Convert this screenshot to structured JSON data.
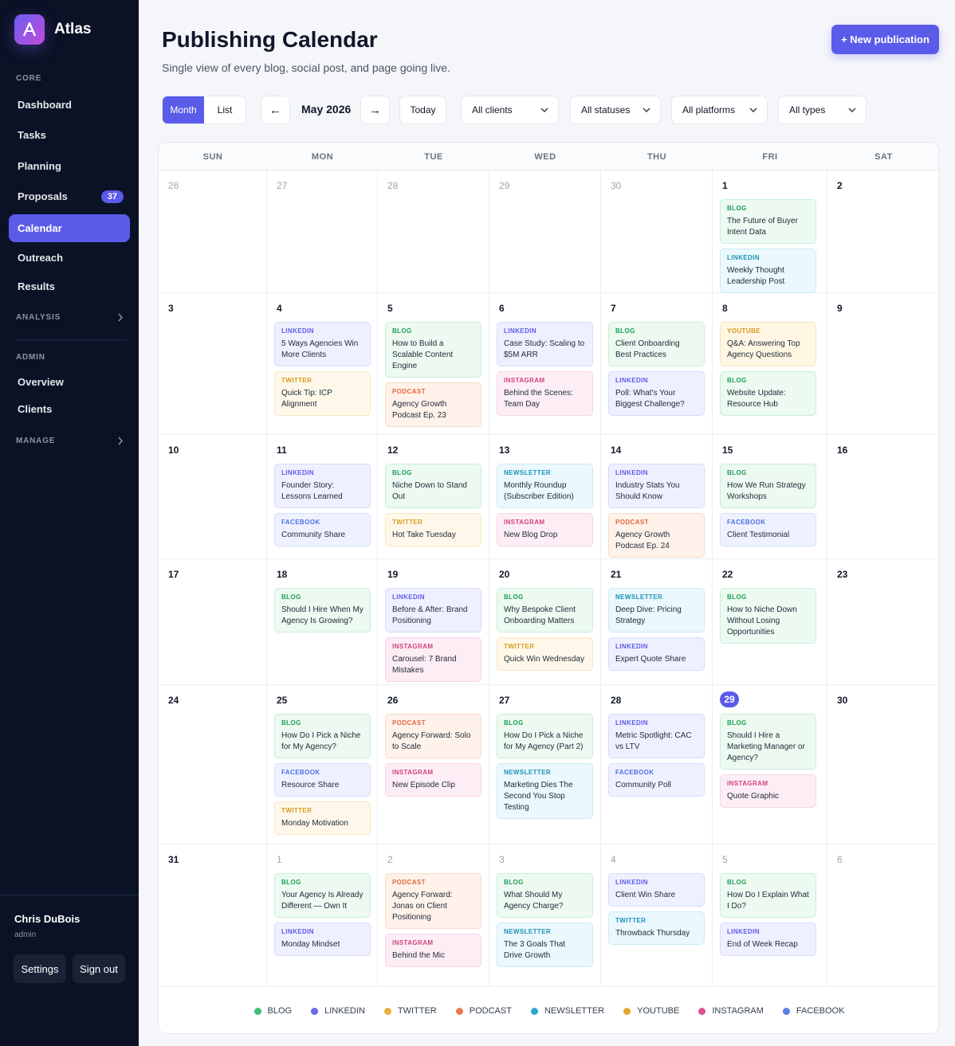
{
  "brand": {
    "name": "Atlas"
  },
  "sidebar": {
    "core_label": "CORE",
    "items": [
      {
        "label": "Dashboard"
      },
      {
        "label": "Tasks"
      },
      {
        "label": "Planning"
      },
      {
        "label": "Proposals",
        "badge": "37"
      },
      {
        "label": "Calendar"
      },
      {
        "label": "Outreach"
      },
      {
        "label": "Results"
      }
    ],
    "analysis_label": "ANALYSIS",
    "admin_label": "ADMIN",
    "admin_items": [
      {
        "label": "Overview"
      },
      {
        "label": "Clients"
      }
    ],
    "manage_label": "MANAGE",
    "user": {
      "name": "Chris DuBois",
      "role": "admin"
    },
    "settings_label": "Settings",
    "signout_label": "Sign out"
  },
  "header": {
    "title": "Publishing Calendar",
    "subtitle": "Single view of every blog, social post, and page going live.",
    "new_button": "+ New publication"
  },
  "toolbar": {
    "view_month": "Month",
    "view_list": "List",
    "prev": "←",
    "next": "→",
    "month": "May 2026",
    "today": "Today",
    "filters": [
      "All clients",
      "All statuses",
      "All platforms",
      "All types"
    ]
  },
  "calendar": {
    "weekdays": [
      "SUN",
      "MON",
      "TUE",
      "WED",
      "THU",
      "FRI",
      "SAT"
    ],
    "today": "29",
    "weeks": [
      [
        {
          "d": "26",
          "out": true,
          "e": []
        },
        {
          "d": "27",
          "out": true,
          "e": []
        },
        {
          "d": "28",
          "out": true,
          "e": []
        },
        {
          "d": "29",
          "out": true,
          "e": []
        },
        {
          "d": "30",
          "out": true,
          "e": []
        },
        {
          "d": "1",
          "e": [
            {
              "t": "blog",
              "tag": "BLOG",
              "title": "The Future of Buyer Intent Data"
            },
            {
              "t": "newsletter",
              "tag": "LINKEDIN",
              "title": "Weekly Thought Leadership Post"
            }
          ]
        },
        {
          "d": "2",
          "e": []
        }
      ],
      [
        {
          "d": "3",
          "e": []
        },
        {
          "d": "4",
          "e": [
            {
              "t": "linkedin",
              "tag": "LINKEDIN",
              "title": "5 Ways Agencies Win More Clients"
            },
            {
              "t": "twitter",
              "tag": "TWITTER",
              "title": "Quick Tip: ICP Alignment"
            }
          ]
        },
        {
          "d": "5",
          "e": [
            {
              "t": "blog",
              "tag": "BLOG",
              "title": "How to Build a Scalable Content Engine"
            },
            {
              "t": "podcast",
              "tag": "PODCAST",
              "title": "Agency Growth Podcast Ep. 23"
            }
          ]
        },
        {
          "d": "6",
          "e": [
            {
              "t": "linkedin",
              "tag": "LINKEDIN",
              "title": "Case Study: Scaling to $5M ARR"
            },
            {
              "t": "instagram",
              "tag": "INSTAGRAM",
              "title": "Behind the Scenes: Team Day"
            }
          ]
        },
        {
          "d": "7",
          "e": [
            {
              "t": "blog",
              "tag": "BLOG",
              "title": "Client Onboarding Best Practices"
            },
            {
              "t": "linkedin",
              "tag": "LINKEDIN",
              "title": "Poll: What's Your Biggest Challenge?"
            }
          ]
        },
        {
          "d": "8",
          "e": [
            {
              "t": "youtube",
              "tag": "YOUTUBE",
              "title": "Q&A: Answering Top Agency Questions"
            },
            {
              "t": "blog",
              "tag": "BLOG",
              "title": "Website Update: Resource Hub"
            }
          ]
        },
        {
          "d": "9",
          "e": []
        }
      ],
      [
        {
          "d": "10",
          "e": []
        },
        {
          "d": "11",
          "e": [
            {
              "t": "linkedin",
              "tag": "LINKEDIN",
              "title": "Founder Story: Lessons Learned"
            },
            {
              "t": "facebook",
              "tag": "FACEBOOK",
              "title": "Community Share"
            }
          ]
        },
        {
          "d": "12",
          "e": [
            {
              "t": "blog",
              "tag": "BLOG",
              "title": "Niche Down to Stand Out"
            },
            {
              "t": "twitter",
              "tag": "TWITTER",
              "title": "Hot Take Tuesday"
            }
          ]
        },
        {
          "d": "13",
          "e": [
            {
              "t": "newsletter",
              "tag": "NEWSLETTER",
              "title": "Monthly Roundup (Subscriber Edition)"
            },
            {
              "t": "instagram",
              "tag": "INSTAGRAM",
              "title": "New Blog Drop"
            }
          ]
        },
        {
          "d": "14",
          "e": [
            {
              "t": "linkedin",
              "tag": "LINKEDIN",
              "title": "Industry Stats You Should Know"
            },
            {
              "t": "podcast",
              "tag": "PODCAST",
              "title": "Agency Growth Podcast Ep. 24"
            }
          ]
        },
        {
          "d": "15",
          "e": [
            {
              "t": "blog",
              "tag": "BLOG",
              "title": "How We Run Strategy Workshops"
            },
            {
              "t": "facebook",
              "tag": "FACEBOOK",
              "title": "Client Testimonial"
            }
          ]
        },
        {
          "d": "16",
          "e": []
        }
      ],
      [
        {
          "d": "17",
          "e": []
        },
        {
          "d": "18",
          "e": [
            {
              "t": "blog",
              "tag": "BLOG",
              "title": "Should I Hire When My Agency Is Growing?"
            }
          ]
        },
        {
          "d": "19",
          "e": [
            {
              "t": "linkedin",
              "tag": "LINKEDIN",
              "title": "Before & After: Brand Positioning"
            },
            {
              "t": "instagram",
              "tag": "INSTAGRAM",
              "title": "Carousel: 7 Brand Mistakes"
            }
          ]
        },
        {
          "d": "20",
          "e": [
            {
              "t": "blog",
              "tag": "BLOG",
              "title": "Why Bespoke Client Onboarding Matters"
            },
            {
              "t": "twitter",
              "tag": "TWITTER",
              "title": "Quick Win Wednesday"
            }
          ]
        },
        {
          "d": "21",
          "e": [
            {
              "t": "newsletter",
              "tag": "NEWSLETTER",
              "title": "Deep Dive: Pricing Strategy"
            },
            {
              "t": "linkedin",
              "tag": "LINKEDIN",
              "title": "Expert Quote Share"
            }
          ]
        },
        {
          "d": "22",
          "e": [
            {
              "t": "blog",
              "tag": "BLOG",
              "title": "How to Niche Down Without Losing Opportunities"
            }
          ]
        },
        {
          "d": "23",
          "e": []
        }
      ],
      [
        {
          "d": "24",
          "e": []
        },
        {
          "d": "25",
          "e": [
            {
              "t": "blog",
              "tag": "BLOG",
              "title": "How Do I Pick a Niche for My Agency?"
            },
            {
              "t": "facebook",
              "tag": "FACEBOOK",
              "title": "Resource Share"
            },
            {
              "t": "twitter",
              "tag": "TWITTER",
              "title": "Monday Motivation"
            }
          ]
        },
        {
          "d": "26",
          "e": [
            {
              "t": "podcast",
              "tag": "PODCAST",
              "title": "Agency Forward: Solo to Scale"
            },
            {
              "t": "instagram",
              "tag": "INSTAGRAM",
              "title": "New Episode Clip"
            }
          ]
        },
        {
          "d": "27",
          "e": [
            {
              "t": "blog",
              "tag": "BLOG",
              "title": "How Do I Pick a Niche for My Agency (Part 2)"
            },
            {
              "t": "newsletter",
              "tag": "NEWSLETTER",
              "title": "Marketing Dies The Second You Stop Testing"
            }
          ]
        },
        {
          "d": "28",
          "e": [
            {
              "t": "linkedin",
              "tag": "LINKEDIN",
              "title": "Metric Spotlight: CAC vs LTV"
            },
            {
              "t": "facebook",
              "tag": "FACEBOOK",
              "title": "Community Poll"
            }
          ]
        },
        {
          "d": "29",
          "today": true,
          "e": [
            {
              "t": "blog",
              "tag": "BLOG",
              "title": "Should I Hire a Marketing Manager or Agency?"
            },
            {
              "t": "instagram",
              "tag": "INSTAGRAM",
              "title": "Quote Graphic"
            }
          ]
        },
        {
          "d": "30",
          "e": []
        }
      ],
      [
        {
          "d": "31",
          "e": []
        },
        {
          "d": "1",
          "out": true,
          "e": [
            {
              "t": "blog",
              "tag": "BLOG",
              "title": "Your Agency Is Already Different — Own It"
            },
            {
              "t": "linkedin",
              "tag": "LINKEDIN",
              "title": "Monday Mindset"
            }
          ]
        },
        {
          "d": "2",
          "out": true,
          "e": [
            {
              "t": "podcast",
              "tag": "PODCAST",
              "title": "Agency Forward: Jonas on Client Positioning"
            },
            {
              "t": "instagram",
              "tag": "INSTAGRAM",
              "title": "Behind the Mic"
            }
          ]
        },
        {
          "d": "3",
          "out": true,
          "e": [
            {
              "t": "blog",
              "tag": "BLOG",
              "title": "What Should My Agency Charge?"
            },
            {
              "t": "newsletter",
              "tag": "NEWSLETTER",
              "title": "The 3 Goals That Drive Growth"
            }
          ]
        },
        {
          "d": "4",
          "out": true,
          "e": [
            {
              "t": "linkedin",
              "tag": "LINKEDIN",
              "title": "Client Win Share"
            },
            {
              "t": "newsletter",
              "tag": "TWITTER",
              "title": "Throwback Thursday"
            }
          ]
        },
        {
          "d": "5",
          "out": true,
          "e": [
            {
              "t": "blog",
              "tag": "BLOG",
              "title": "How Do I Explain What I Do?"
            },
            {
              "t": "linkedin",
              "tag": "LINKEDIN",
              "title": "End of Week Recap"
            }
          ]
        },
        {
          "d": "6",
          "out": true,
          "e": []
        }
      ]
    ]
  },
  "legend": [
    {
      "label": "BLOG",
      "color": "#3fbf74"
    },
    {
      "label": "LINKEDIN",
      "color": "#6a6aee"
    },
    {
      "label": "TWITTER",
      "color": "#e8b23a"
    },
    {
      "label": "PODCAST",
      "color": "#ec7a4a"
    },
    {
      "label": "NEWSLETTER",
      "color": "#2fa7cc"
    },
    {
      "label": "YOUTUBE",
      "color": "#e6a62a"
    },
    {
      "label": "INSTAGRAM",
      "color": "#dc5590"
    },
    {
      "label": "FACEBOOK",
      "color": "#5f7ee6"
    }
  ]
}
